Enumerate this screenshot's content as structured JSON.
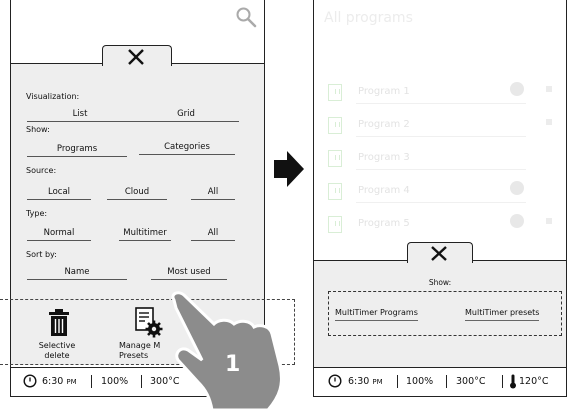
{
  "left_screen": {
    "filter_panel": {
      "visualization": {
        "label": "Visualization:",
        "options": [
          "List",
          "Grid"
        ]
      },
      "show": {
        "label": "Show:",
        "options": [
          "Programs",
          "Categories"
        ]
      },
      "source": {
        "label": "Source:",
        "options": [
          "Local",
          "Cloud",
          "All"
        ]
      },
      "type": {
        "label": "Type:",
        "options": [
          "Normal",
          "Multitimer",
          "All"
        ]
      },
      "sort_by": {
        "label": "Sort by:",
        "options": [
          "Name",
          "Most used"
        ]
      }
    },
    "actions": {
      "selective_delete": "Selective\ndelete",
      "manage_presets": "Manage M\nPresets"
    },
    "callout_number": "1",
    "status": {
      "time": "6:30",
      "ampm": "PM",
      "power": "100%",
      "temp": "300°C"
    }
  },
  "right_screen": {
    "title": "All programs",
    "programs": [
      "Program 1",
      "Program 2",
      "Program 3",
      "Program 4",
      "Program 5"
    ],
    "show_panel": {
      "label": "Show:",
      "options": [
        "MultiTimer Programs",
        "MultiTimer presets"
      ]
    },
    "status": {
      "time": "6:30",
      "ampm": "PM",
      "power": "100%",
      "temp": "300°C",
      "probe_temp": "120°C"
    }
  },
  "colors": {
    "accent_green": "#d9eed6",
    "panel_gray": "#eeeeee",
    "border": "#222222"
  }
}
